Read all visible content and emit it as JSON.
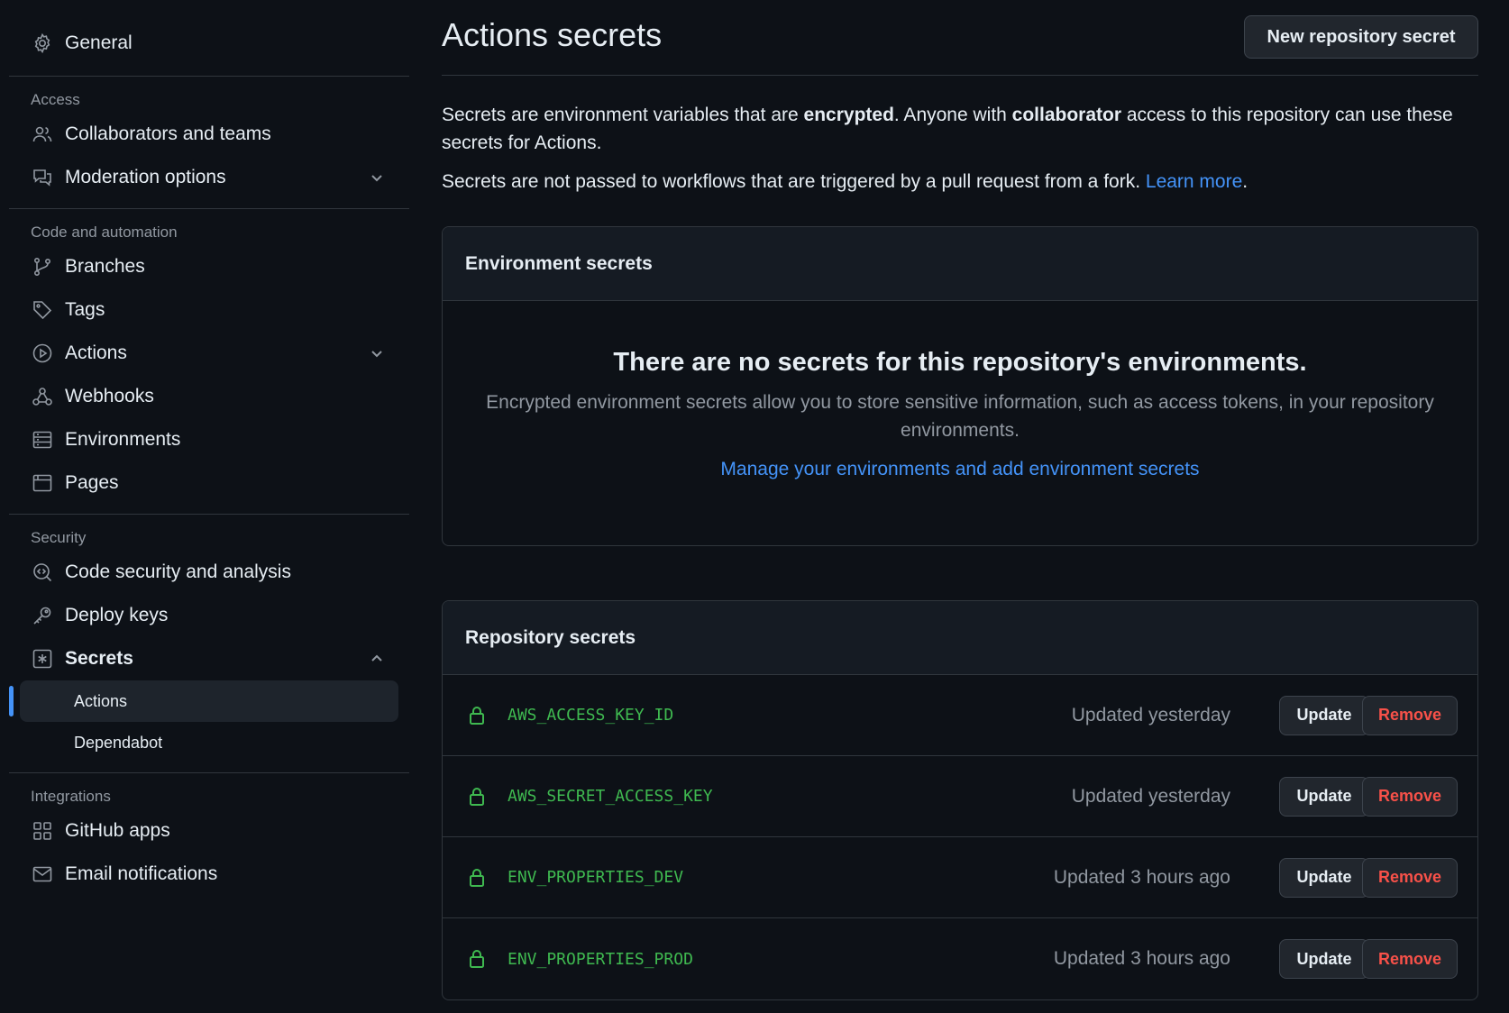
{
  "sidebar": {
    "general": "General",
    "sections": {
      "access": "Access",
      "code_automation": "Code and automation",
      "security": "Security",
      "integrations": "Integrations"
    },
    "items": {
      "collaborators": "Collaborators and teams",
      "moderation": "Moderation options",
      "branches": "Branches",
      "tags": "Tags",
      "actions": "Actions",
      "webhooks": "Webhooks",
      "environments": "Environments",
      "pages": "Pages",
      "code_security": "Code security and analysis",
      "deploy_keys": "Deploy keys",
      "secrets": "Secrets",
      "secrets_actions": "Actions",
      "secrets_dependabot": "Dependabot",
      "github_apps": "GitHub apps",
      "email_notifications": "Email notifications"
    }
  },
  "main": {
    "title": "Actions secrets",
    "new_secret_button": "New repository secret",
    "intro": {
      "p1_a": "Secrets are environment variables that are ",
      "p1_b": "encrypted",
      "p1_c": ". Anyone with ",
      "p1_d": "collaborator",
      "p1_e": " access to this repository can use these secrets for Actions.",
      "p2_a": "Secrets are not passed to workflows that are triggered by a pull request from a fork. ",
      "p2_link": "Learn more",
      "p2_end": "."
    },
    "environment_secrets": {
      "header": "Environment secrets",
      "empty_title": "There are no secrets for this repository's environments.",
      "empty_desc": "Encrypted environment secrets allow you to store sensitive information, such as access tokens, in your repository environments.",
      "manage_link": "Manage your environments and add environment secrets"
    },
    "repository_secrets": {
      "header": "Repository secrets",
      "update_label": "Update",
      "remove_label": "Remove",
      "rows": [
        {
          "name": "AWS_ACCESS_KEY_ID",
          "updated": "Updated yesterday"
        },
        {
          "name": "AWS_SECRET_ACCESS_KEY",
          "updated": "Updated yesterday"
        },
        {
          "name": "ENV_PROPERTIES_DEV",
          "updated": "Updated 3 hours ago"
        },
        {
          "name": "ENV_PROPERTIES_PROD",
          "updated": "Updated 3 hours ago"
        }
      ]
    }
  },
  "colors": {
    "background": "#0d1117",
    "accent": "#4493f8",
    "success": "#3fb950",
    "danger": "#f85149"
  }
}
